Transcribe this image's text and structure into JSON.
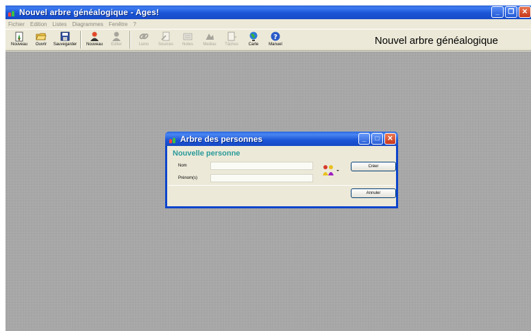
{
  "window": {
    "title": "Nouvel arbre généalogique - Ages!",
    "controls": {
      "minimize": "_",
      "restore": "❐",
      "close": "✕"
    }
  },
  "menu": [
    "Fichier",
    "Edition",
    "Listes",
    "Diagrammes",
    "Fenêtre",
    "?"
  ],
  "toolbar": {
    "buttons": [
      {
        "label": "Nouveau",
        "icon": "new-tree-icon",
        "enabled": true
      },
      {
        "label": "Ouvrir",
        "icon": "open-folder-icon",
        "enabled": true
      },
      {
        "label": "Sauvegarder",
        "icon": "save-disk-icon",
        "enabled": true
      },
      {
        "label": "Nouveau",
        "icon": "new-person-icon",
        "enabled": true
      },
      {
        "label": "Editer",
        "icon": "edit-person-icon",
        "enabled": false
      },
      {
        "label": "Liens",
        "icon": "links-icon",
        "enabled": false
      },
      {
        "label": "Sources",
        "icon": "sources-icon",
        "enabled": false
      },
      {
        "label": "Notes",
        "icon": "notes-icon",
        "enabled": false
      },
      {
        "label": "Medias",
        "icon": "medias-icon",
        "enabled": false
      },
      {
        "label": "Tâches",
        "icon": "tasks-icon",
        "enabled": false
      },
      {
        "label": "Carte",
        "icon": "globe-icon",
        "enabled": true
      },
      {
        "label": "Manuel",
        "icon": "help-icon",
        "enabled": true
      }
    ],
    "document_title": "Nouvel arbre généalogique"
  },
  "dialog": {
    "title": "Arbre des personnes",
    "heading": "Nouvelle personne",
    "fields": {
      "nom": {
        "label": "Nom",
        "value": ""
      },
      "prenoms": {
        "label": "Prénom(s)",
        "value": ""
      }
    },
    "buttons": {
      "create": "Créer",
      "cancel": "Annuler"
    },
    "controls": {
      "minimize": "_",
      "maximize": "□",
      "close": "✕"
    }
  },
  "colors": {
    "title_blue": "#1b55d6",
    "chrome": "#ece9d8",
    "workspace": "#a9a9a9",
    "heading_teal": "#2a9a9a"
  }
}
